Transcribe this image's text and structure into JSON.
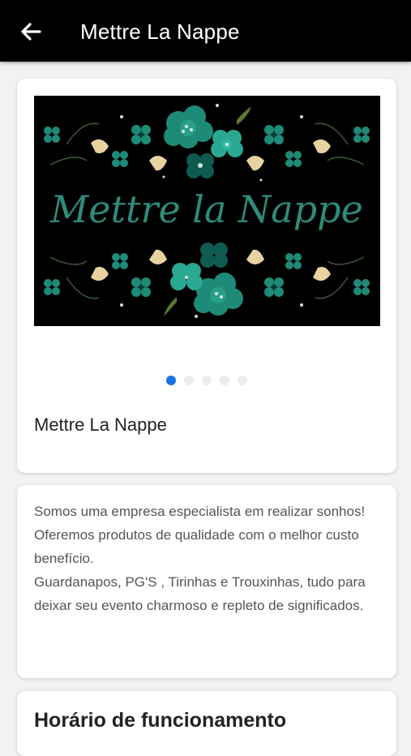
{
  "appbar": {
    "title": "Mettre La Nappe",
    "back_icon": "arrow-left-icon"
  },
  "hero": {
    "banner_text": "Mettre la Nappe",
    "slide_count": 5,
    "active_slide": 1,
    "title": "Mettre La Nappe"
  },
  "description": {
    "lines": [
      "Somos uma empresa especialista em realizar sonhos!",
      "Oferemos produtos de qualidade com o melhor custo benefício.",
      "Guardanapos, PG'S , Tirinhas e Trouxinhas, tudo para deixar seu evento charmoso e repleto de significados."
    ]
  },
  "hours": {
    "title": "Horário de funcionamento"
  },
  "colors": {
    "appbar": "#000000",
    "accent_dot": "#1a73e8",
    "banner_text": "#2e8b7a",
    "flower_teal": "#1e8a78",
    "flower_dark": "#0f5b4f",
    "tulip": "#e8d3a0"
  }
}
